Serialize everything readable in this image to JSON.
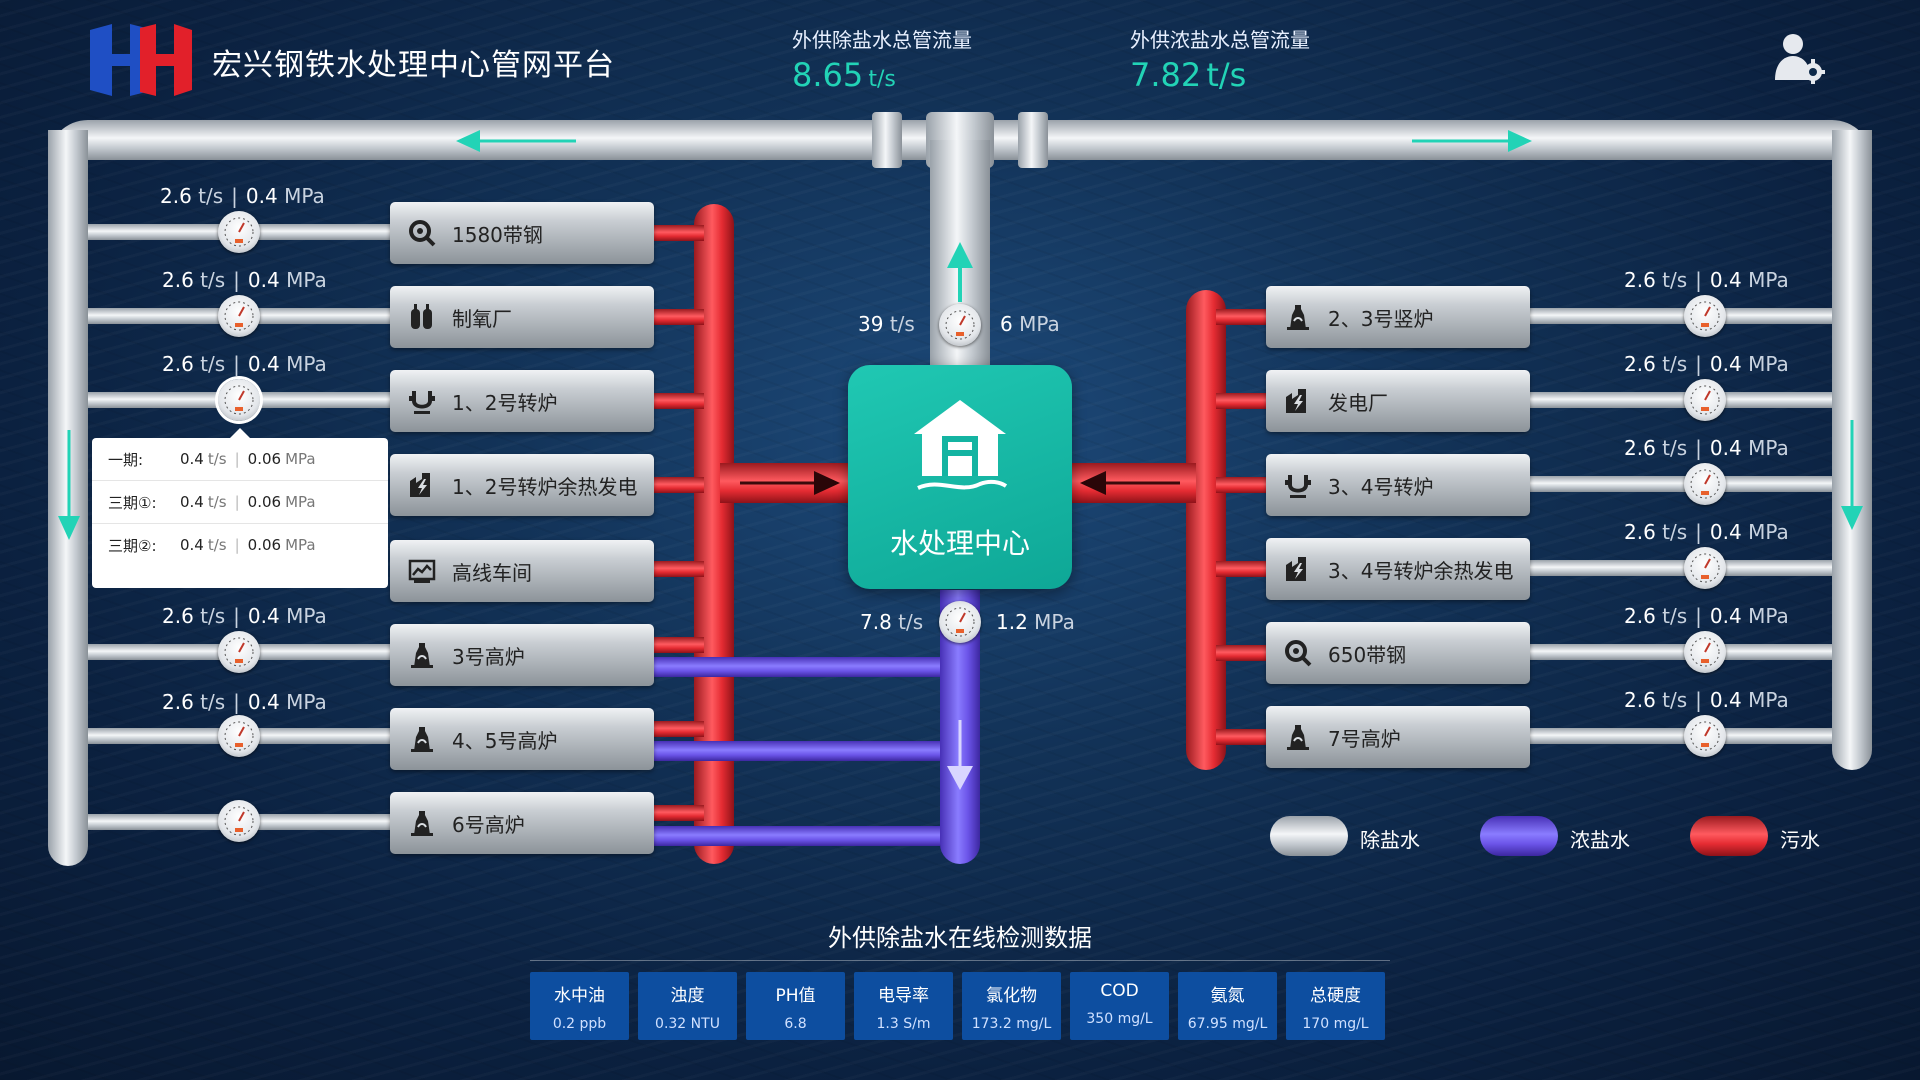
{
  "header": {
    "title": "宏兴钢铁水处理中心管网平台",
    "desalt_flow": {
      "label": "外供除盐水总管流量",
      "value": "8.65",
      "unit": "t/s"
    },
    "brine_flow": {
      "label": "外供浓盐水总管流量",
      "value": "7.82",
      "unit": "t/s"
    }
  },
  "left_plants": [
    {
      "label": "1580带钢",
      "icon": "search-icon"
    },
    {
      "label": "制氧厂",
      "icon": "oxygen-tank-icon"
    },
    {
      "label": "1、2号转炉",
      "icon": "converter-icon"
    },
    {
      "label": "1、2号转炉余热发电",
      "icon": "power-plant-icon"
    },
    {
      "label": "高线车间",
      "icon": "workshop-icon"
    },
    {
      "label": "3号高炉",
      "icon": "blast-furnace-icon"
    },
    {
      "label": "4、5号高炉",
      "icon": "blast-furnace-icon"
    },
    {
      "label": "6号高炉",
      "icon": "blast-furnace-icon"
    }
  ],
  "right_plants": [
    {
      "label": "2、3号竖炉",
      "icon": "blast-furnace-icon"
    },
    {
      "label": "发电厂",
      "icon": "power-plant-icon"
    },
    {
      "label": "3、4号转炉",
      "icon": "converter-icon"
    },
    {
      "label": "3、4号转炉余热发电",
      "icon": "power-plant-icon"
    },
    {
      "label": "650带钢",
      "icon": "search-icon"
    },
    {
      "label": "7号高炉",
      "icon": "blast-furnace-icon"
    }
  ],
  "left_readings": [
    {
      "flow": "2.6",
      "flow_unit": "t/s",
      "pressure": "0.4",
      "pressure_unit": "MPa"
    },
    {
      "flow": "2.6",
      "flow_unit": "t/s",
      "pressure": "0.4",
      "pressure_unit": "MPa"
    },
    {
      "flow": "2.6",
      "flow_unit": "t/s",
      "pressure": "0.4",
      "pressure_unit": "MPa"
    },
    {
      "flow": "2.6",
      "flow_unit": "t/s",
      "pressure": "0.4",
      "pressure_unit": "MPa"
    },
    {
      "flow": "2.6",
      "flow_unit": "t/s",
      "pressure": "0.4",
      "pressure_unit": "MPa"
    }
  ],
  "right_readings": [
    {
      "flow": "2.6",
      "flow_unit": "t/s",
      "pressure": "0.4",
      "pressure_unit": "MPa"
    },
    {
      "flow": "2.6",
      "flow_unit": "t/s",
      "pressure": "0.4",
      "pressure_unit": "MPa"
    },
    {
      "flow": "2.6",
      "flow_unit": "t/s",
      "pressure": "0.4",
      "pressure_unit": "MPa"
    },
    {
      "flow": "2.6",
      "flow_unit": "t/s",
      "pressure": "0.4",
      "pressure_unit": "MPa"
    },
    {
      "flow": "2.6",
      "flow_unit": "t/s",
      "pressure": "0.4",
      "pressure_unit": "MPa"
    },
    {
      "flow": "2.6",
      "flow_unit": "t/s",
      "pressure": "0.4",
      "pressure_unit": "MPa"
    }
  ],
  "center": {
    "label": "水处理中心",
    "top_reading": {
      "flow": "39",
      "flow_unit": "t/s",
      "pressure": "6",
      "pressure_unit": "MPa"
    },
    "bottom_reading": {
      "flow": "7.8",
      "flow_unit": "t/s",
      "pressure": "1.2",
      "pressure_unit": "MPa"
    }
  },
  "popup": {
    "rows": [
      {
        "label": "一期:",
        "flow": "0.4",
        "flow_unit": "t/s",
        "pressure": "0.06",
        "pressure_unit": "MPa"
      },
      {
        "label": "三期①:",
        "flow": "0.4",
        "flow_unit": "t/s",
        "pressure": "0.06",
        "pressure_unit": "MPa"
      },
      {
        "label": "三期②:",
        "flow": "0.4",
        "flow_unit": "t/s",
        "pressure": "0.06",
        "pressure_unit": "MPa"
      }
    ]
  },
  "legend": [
    {
      "label": "除盐水",
      "color": "#c7ccd1"
    },
    {
      "label": "浓盐水",
      "color": "#6a55f0"
    },
    {
      "label": "污水",
      "color": "#e8323a"
    }
  ],
  "monitor": {
    "title": "外供除盐水在线检测数据",
    "items": [
      {
        "name": "水中油",
        "value": "0.2 ppb"
      },
      {
        "name": "浊度",
        "value": "0.32 NTU"
      },
      {
        "name": "PH值",
        "value": "6.8"
      },
      {
        "name": "电导率",
        "value": "1.3 S/m"
      },
      {
        "name": "氯化物",
        "value": "173.2 mg/L"
      },
      {
        "name": "COD",
        "value": "350 mg/L"
      },
      {
        "name": "氨氮",
        "value": "67.95 mg/L"
      },
      {
        "name": "总硬度",
        "value": "170 mg/L"
      }
    ]
  },
  "colors": {
    "accent": "#22d3b6",
    "desalt": "#c7ccd1",
    "brine": "#6a55f0",
    "sewage": "#e8323a",
    "cell_bg": "#0d4ea0"
  }
}
